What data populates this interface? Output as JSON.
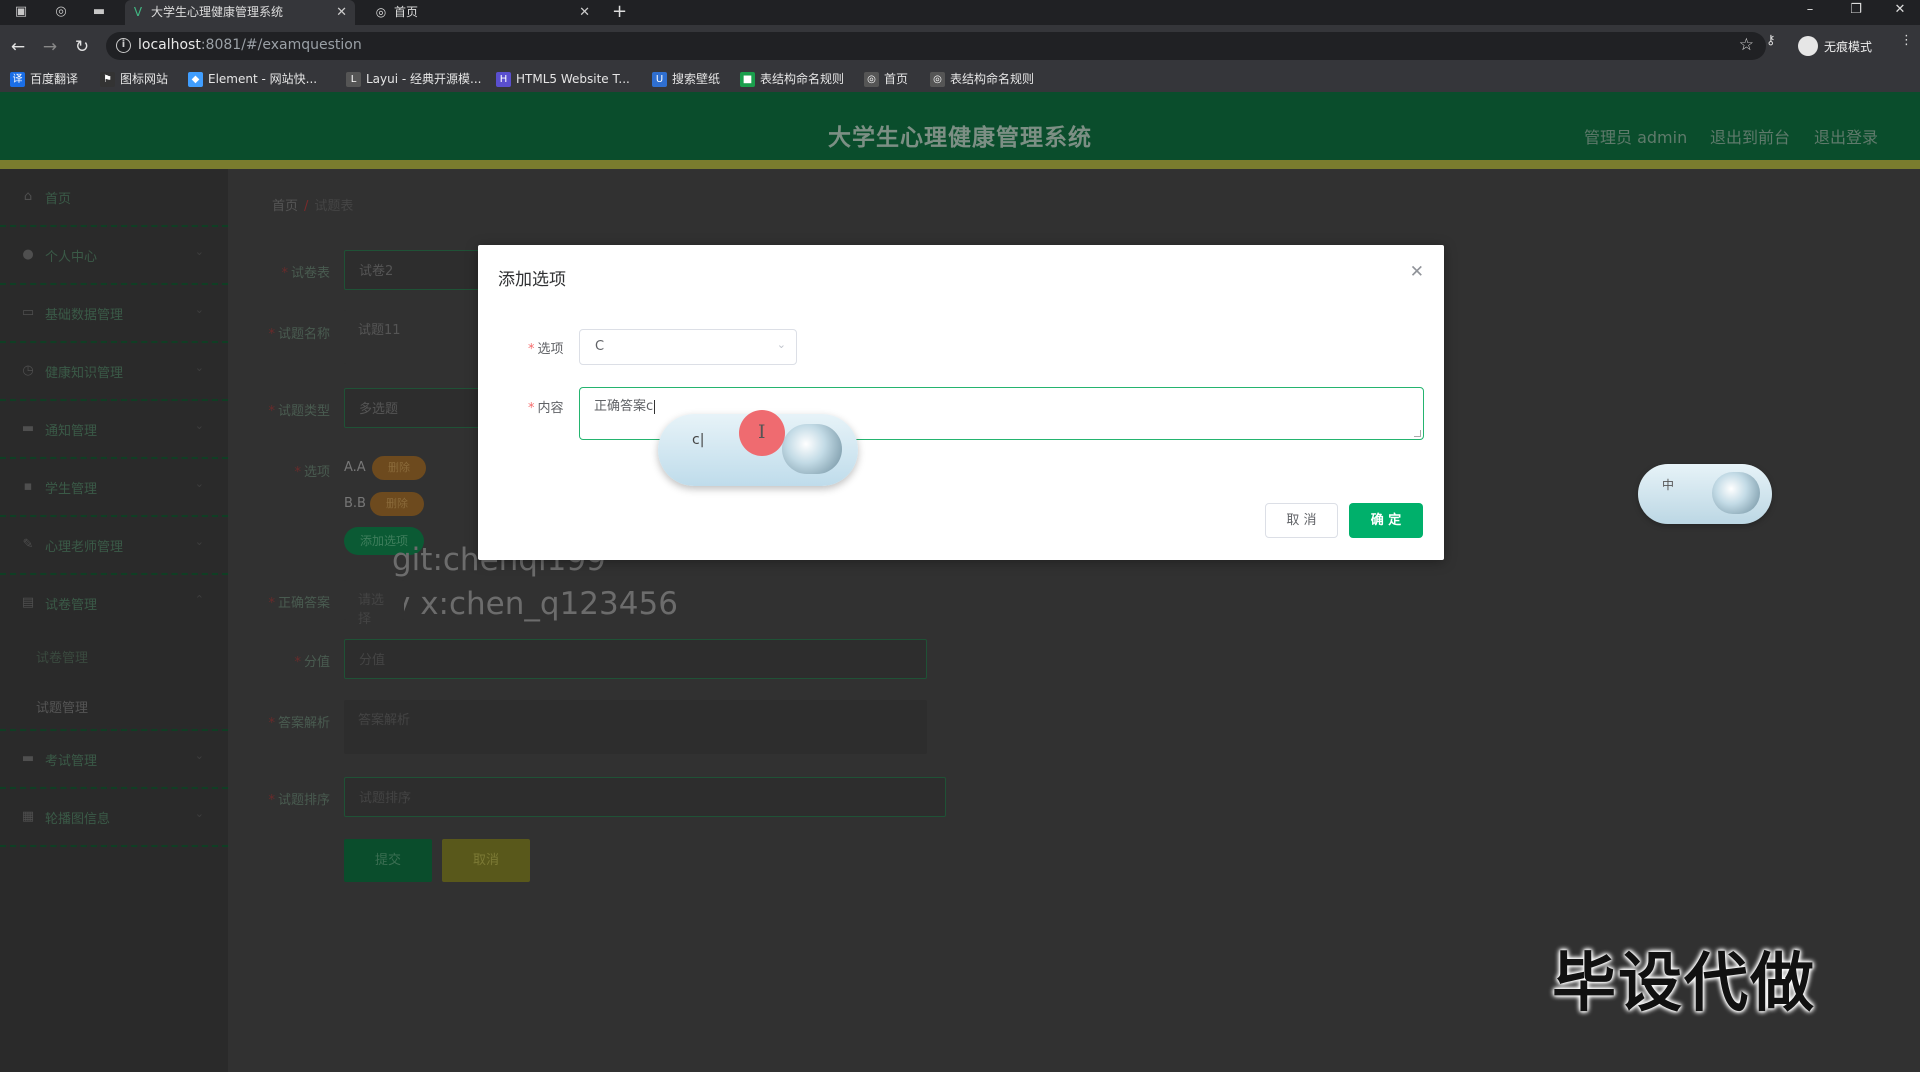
{
  "browser": {
    "tabs": [
      {
        "title": "大学生心理健康管理系统",
        "active": true
      },
      {
        "title": "首页",
        "active": false
      }
    ],
    "url_host": "localhost",
    "url_path": ":8081/#/examquestion",
    "incognito_label": "无痕模式",
    "bookmarks": [
      {
        "label": "百度翻译",
        "color": "#1a6ee6",
        "glyph": "译"
      },
      {
        "label": "图标网站",
        "color": "#333333",
        "glyph": "⚑"
      },
      {
        "label": "Element - 网站快...",
        "color": "#409eff",
        "glyph": "◆"
      },
      {
        "label": "Layui - 经典开源模...",
        "color": "#555555",
        "glyph": "L"
      },
      {
        "label": "HTML5 Website T...",
        "color": "#5a4fcf",
        "glyph": "H"
      },
      {
        "label": "搜索壁纸",
        "color": "#2f6fd0",
        "glyph": "U"
      },
      {
        "label": "表结构命名规则",
        "color": "#1a9e4c",
        "glyph": "■"
      },
      {
        "label": "首页",
        "color": "#555555",
        "glyph": "◎"
      },
      {
        "label": "表结构命名规则",
        "color": "#555555",
        "glyph": "◎"
      }
    ]
  },
  "app": {
    "title": "大学生心理健康管理系统",
    "header_links": [
      "管理员 admin",
      "退出到前台",
      "退出登录"
    ]
  },
  "sidebar": {
    "items": [
      {
        "label": "首页",
        "icon": "home-icon",
        "glyph": "⌂",
        "arrow": false
      },
      {
        "label": "个人中心",
        "icon": "user-icon",
        "glyph": "●",
        "arrow": true
      },
      {
        "label": "基础数据管理",
        "icon": "chat-icon",
        "glyph": "▭",
        "arrow": true
      },
      {
        "label": "健康知识管理",
        "icon": "clock-icon",
        "glyph": "◷",
        "arrow": true
      },
      {
        "label": "通知管理",
        "icon": "bell-icon",
        "glyph": "▬",
        "arrow": true
      },
      {
        "label": "学生管理",
        "icon": "monitor-icon",
        "glyph": "▪",
        "arrow": true
      },
      {
        "label": "心理老师管理",
        "icon": "edit-icon",
        "glyph": "✎",
        "arrow": true
      },
      {
        "label": "试卷管理",
        "icon": "lock-icon",
        "glyph": "▤",
        "arrow": true
      },
      {
        "label": "考试管理",
        "icon": "monitor-icon",
        "glyph": "▬",
        "arrow": true
      },
      {
        "label": "轮播图信息",
        "icon": "grid-icon",
        "glyph": "▦",
        "arrow": true
      }
    ],
    "sub_items": [
      "试卷管理",
      "试题管理"
    ]
  },
  "breadcrumb": {
    "home": "首页",
    "current": "试题表"
  },
  "form": {
    "paper_label": "试卷表",
    "paper_value": "试卷2",
    "name_label": "试题名称",
    "name_value": "试题11",
    "type_label": "试题类型",
    "type_value": "多选题",
    "options_label": "选项",
    "options": [
      {
        "text": "A.A",
        "delete": "删除"
      },
      {
        "text": "B.B",
        "delete": "删除"
      }
    ],
    "add_option": "添加选项",
    "answer_label": "正确答案",
    "answer_placeholder": "请选择",
    "score_label": "分值",
    "score_placeholder": "分值",
    "analysis_label": "答案解析",
    "analysis_placeholder": "答案解析",
    "order_label": "试题排序",
    "order_placeholder": "试题排序",
    "submit": "提交",
    "cancel": "取消"
  },
  "watermark": [
    "git:chenqi199",
    "v x:chen_q123456"
  ],
  "modal": {
    "title": "添加选项",
    "option_label": "选项",
    "option_value": "C",
    "content_label": "内容",
    "content_value": "正确答案c",
    "cancel": "取 消",
    "ok": "确 定"
  },
  "ime": {
    "composition": "c|",
    "mode": "中"
  },
  "overlay_text": "毕设代做",
  "colors": {
    "accent": "#00b06b",
    "header": "#0a4d2c",
    "required": "#f56c6c"
  }
}
